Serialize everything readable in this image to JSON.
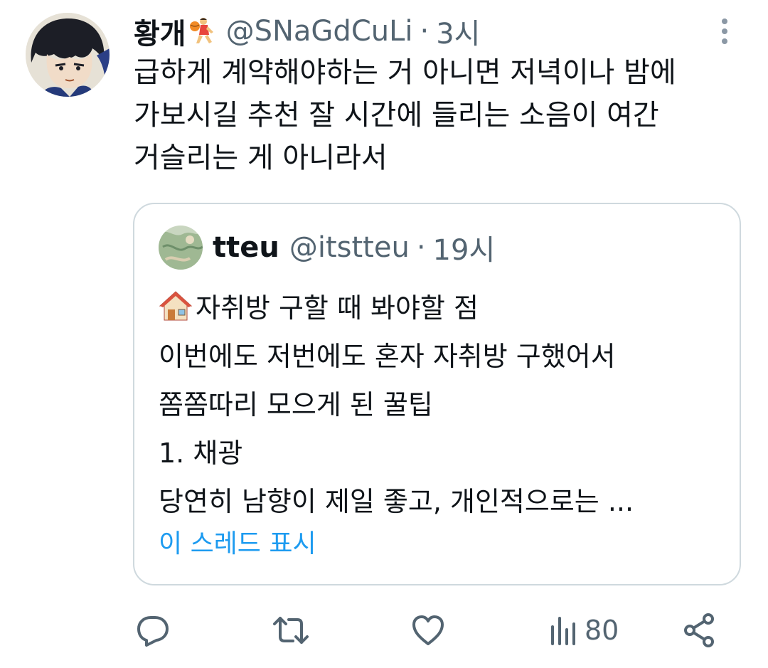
{
  "tweet": {
    "display_name": "황개",
    "name_emoji": "basketball-player-emoji",
    "handle": "@SNaGdCuLi",
    "separator": "·",
    "time": "3시",
    "text": "급하게 계약해야하는 거 아니면 저녁이나 밤에\n가보시길 추천 잘 시간에 들리는 소음이 여간\n거슬리는 게 아니라서"
  },
  "quote": {
    "display_name": "tteu",
    "handle": "@itstteu",
    "separator": "·",
    "time": "19시",
    "lines": [
      "자취방 구할 때 봐야할 점",
      "이번에도 저번에도 혼자 자취방 구했어서",
      "쫌쫌따리 모으게 된 꿀팁",
      "1. 채광",
      "당연히 남향이 제일 좋고, 개인적으로는 ..."
    ],
    "first_line_emoji": "house-emoji",
    "show_thread_label": "이 스레드 표시"
  },
  "actions": {
    "views_count": "80",
    "icons": [
      "reply-icon",
      "retweet-icon",
      "like-icon",
      "views-icon",
      "share-icon"
    ]
  },
  "colors": {
    "text": "#0f1419",
    "secondary": "#536471",
    "link": "#1d9bf0",
    "border": "#cfd9de"
  }
}
